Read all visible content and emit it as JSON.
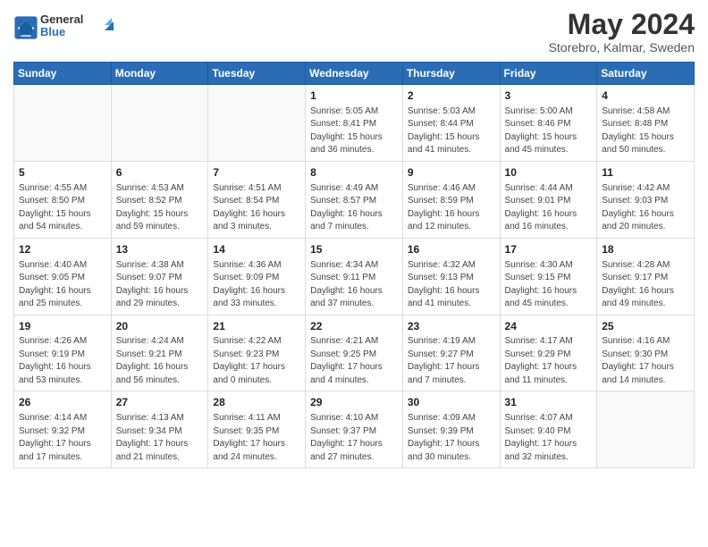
{
  "logo": {
    "text_general": "General",
    "text_blue": "Blue"
  },
  "header": {
    "month_year": "May 2024",
    "location": "Storebro, Kalmar, Sweden"
  },
  "weekdays": [
    "Sunday",
    "Monday",
    "Tuesday",
    "Wednesday",
    "Thursday",
    "Friday",
    "Saturday"
  ],
  "weeks": [
    [
      {
        "day": "",
        "info": ""
      },
      {
        "day": "",
        "info": ""
      },
      {
        "day": "",
        "info": ""
      },
      {
        "day": "1",
        "info": "Sunrise: 5:05 AM\nSunset: 8:41 PM\nDaylight: 15 hours\nand 36 minutes."
      },
      {
        "day": "2",
        "info": "Sunrise: 5:03 AM\nSunset: 8:44 PM\nDaylight: 15 hours\nand 41 minutes."
      },
      {
        "day": "3",
        "info": "Sunrise: 5:00 AM\nSunset: 8:46 PM\nDaylight: 15 hours\nand 45 minutes."
      },
      {
        "day": "4",
        "info": "Sunrise: 4:58 AM\nSunset: 8:48 PM\nDaylight: 15 hours\nand 50 minutes."
      }
    ],
    [
      {
        "day": "5",
        "info": "Sunrise: 4:55 AM\nSunset: 8:50 PM\nDaylight: 15 hours\nand 54 minutes."
      },
      {
        "day": "6",
        "info": "Sunrise: 4:53 AM\nSunset: 8:52 PM\nDaylight: 15 hours\nand 59 minutes."
      },
      {
        "day": "7",
        "info": "Sunrise: 4:51 AM\nSunset: 8:54 PM\nDaylight: 16 hours\nand 3 minutes."
      },
      {
        "day": "8",
        "info": "Sunrise: 4:49 AM\nSunset: 8:57 PM\nDaylight: 16 hours\nand 7 minutes."
      },
      {
        "day": "9",
        "info": "Sunrise: 4:46 AM\nSunset: 8:59 PM\nDaylight: 16 hours\nand 12 minutes."
      },
      {
        "day": "10",
        "info": "Sunrise: 4:44 AM\nSunset: 9:01 PM\nDaylight: 16 hours\nand 16 minutes."
      },
      {
        "day": "11",
        "info": "Sunrise: 4:42 AM\nSunset: 9:03 PM\nDaylight: 16 hours\nand 20 minutes."
      }
    ],
    [
      {
        "day": "12",
        "info": "Sunrise: 4:40 AM\nSunset: 9:05 PM\nDaylight: 16 hours\nand 25 minutes."
      },
      {
        "day": "13",
        "info": "Sunrise: 4:38 AM\nSunset: 9:07 PM\nDaylight: 16 hours\nand 29 minutes."
      },
      {
        "day": "14",
        "info": "Sunrise: 4:36 AM\nSunset: 9:09 PM\nDaylight: 16 hours\nand 33 minutes."
      },
      {
        "day": "15",
        "info": "Sunrise: 4:34 AM\nSunset: 9:11 PM\nDaylight: 16 hours\nand 37 minutes."
      },
      {
        "day": "16",
        "info": "Sunrise: 4:32 AM\nSunset: 9:13 PM\nDaylight: 16 hours\nand 41 minutes."
      },
      {
        "day": "17",
        "info": "Sunrise: 4:30 AM\nSunset: 9:15 PM\nDaylight: 16 hours\nand 45 minutes."
      },
      {
        "day": "18",
        "info": "Sunrise: 4:28 AM\nSunset: 9:17 PM\nDaylight: 16 hours\nand 49 minutes."
      }
    ],
    [
      {
        "day": "19",
        "info": "Sunrise: 4:26 AM\nSunset: 9:19 PM\nDaylight: 16 hours\nand 53 minutes."
      },
      {
        "day": "20",
        "info": "Sunrise: 4:24 AM\nSunset: 9:21 PM\nDaylight: 16 hours\nand 56 minutes."
      },
      {
        "day": "21",
        "info": "Sunrise: 4:22 AM\nSunset: 9:23 PM\nDaylight: 17 hours\nand 0 minutes."
      },
      {
        "day": "22",
        "info": "Sunrise: 4:21 AM\nSunset: 9:25 PM\nDaylight: 17 hours\nand 4 minutes."
      },
      {
        "day": "23",
        "info": "Sunrise: 4:19 AM\nSunset: 9:27 PM\nDaylight: 17 hours\nand 7 minutes."
      },
      {
        "day": "24",
        "info": "Sunrise: 4:17 AM\nSunset: 9:29 PM\nDaylight: 17 hours\nand 11 minutes."
      },
      {
        "day": "25",
        "info": "Sunrise: 4:16 AM\nSunset: 9:30 PM\nDaylight: 17 hours\nand 14 minutes."
      }
    ],
    [
      {
        "day": "26",
        "info": "Sunrise: 4:14 AM\nSunset: 9:32 PM\nDaylight: 17 hours\nand 17 minutes."
      },
      {
        "day": "27",
        "info": "Sunrise: 4:13 AM\nSunset: 9:34 PM\nDaylight: 17 hours\nand 21 minutes."
      },
      {
        "day": "28",
        "info": "Sunrise: 4:11 AM\nSunset: 9:35 PM\nDaylight: 17 hours\nand 24 minutes."
      },
      {
        "day": "29",
        "info": "Sunrise: 4:10 AM\nSunset: 9:37 PM\nDaylight: 17 hours\nand 27 minutes."
      },
      {
        "day": "30",
        "info": "Sunrise: 4:09 AM\nSunset: 9:39 PM\nDaylight: 17 hours\nand 30 minutes."
      },
      {
        "day": "31",
        "info": "Sunrise: 4:07 AM\nSunset: 9:40 PM\nDaylight: 17 hours\nand 32 minutes."
      },
      {
        "day": "",
        "info": ""
      }
    ]
  ]
}
